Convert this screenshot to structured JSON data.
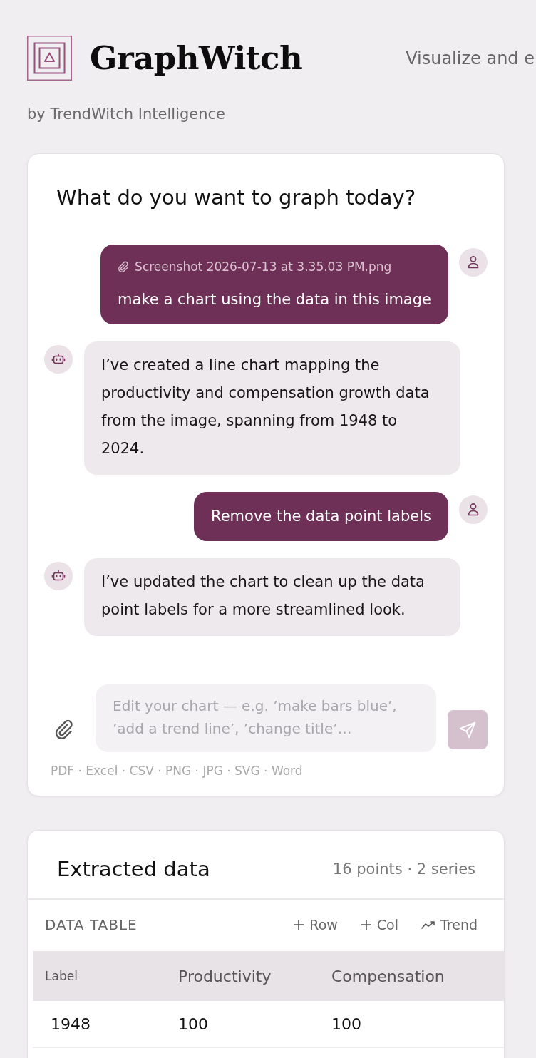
{
  "header": {
    "brand": "GraphWitch",
    "tagline": "Visualize and e",
    "byline": "by TrendWitch Intelligence"
  },
  "chat": {
    "title": "What do you want to graph today?",
    "messages": [
      {
        "kind": "user",
        "attachment": "Screenshot 2026-07-13 at 3.35.03 PM.png",
        "text": "make a chart using the data in this image"
      },
      {
        "kind": "assistant",
        "text": "I’ve created a line chart mapping the productivity and compensation growth data from the image, spanning from 1948 to 2024."
      },
      {
        "kind": "user",
        "text": "Remove the data point labels"
      },
      {
        "kind": "assistant",
        "text": "I’ve updated the chart to clean up the data point labels for a more streamlined look."
      }
    ],
    "input": {
      "placeholder": "Edit your chart — e.g. ’make bars blue’, ’add a trend line’, ’change title’…"
    },
    "send_button": {
      "disabled": true
    },
    "formats": "PDF · Excel · CSV · PNG · JPG · SVG · Word"
  },
  "data_panel": {
    "title": "Extracted data",
    "summary": "16 points · 2 series",
    "table_label": "DATA TABLE",
    "actions": [
      {
        "kind": "add",
        "label": "Row"
      },
      {
        "kind": "add",
        "label": "Col"
      },
      {
        "kind": "trend",
        "label": "Trend"
      }
    ],
    "columns": [
      "Label",
      "Productivity",
      "Compensation"
    ],
    "rows": [
      [
        "1948",
        "100",
        "100"
      ]
    ]
  }
}
